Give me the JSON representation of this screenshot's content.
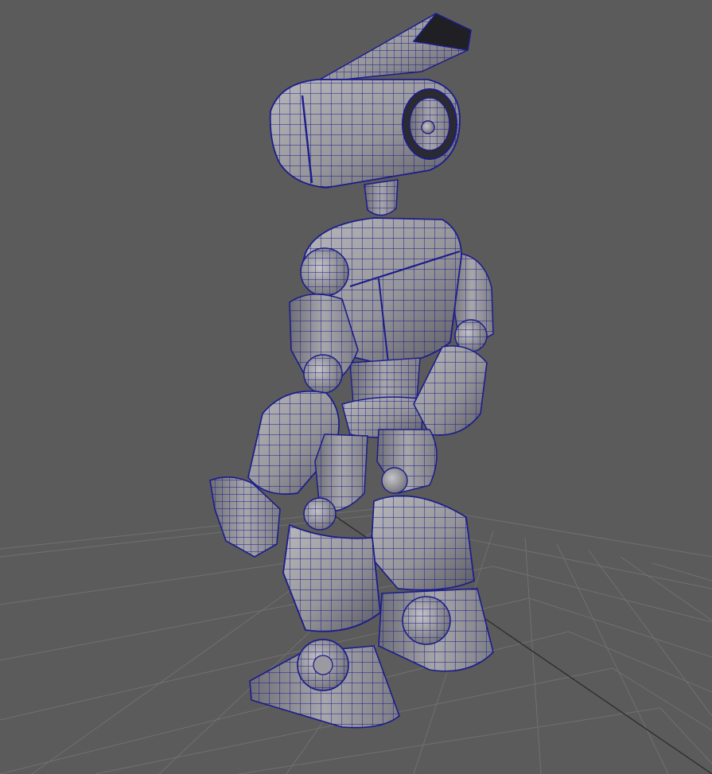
{
  "viewport": {
    "background": "#5b5b5b",
    "grid_line_color": "#707070",
    "grid_axis_color": "#2e2e2e"
  },
  "model": {
    "surface_color": "#8c8c8f",
    "surface_light": "#b4b4b8",
    "surface_dark": "#4a4a52",
    "wire_color": "#1c1c8c",
    "visor_interior": "#1f1f24"
  }
}
